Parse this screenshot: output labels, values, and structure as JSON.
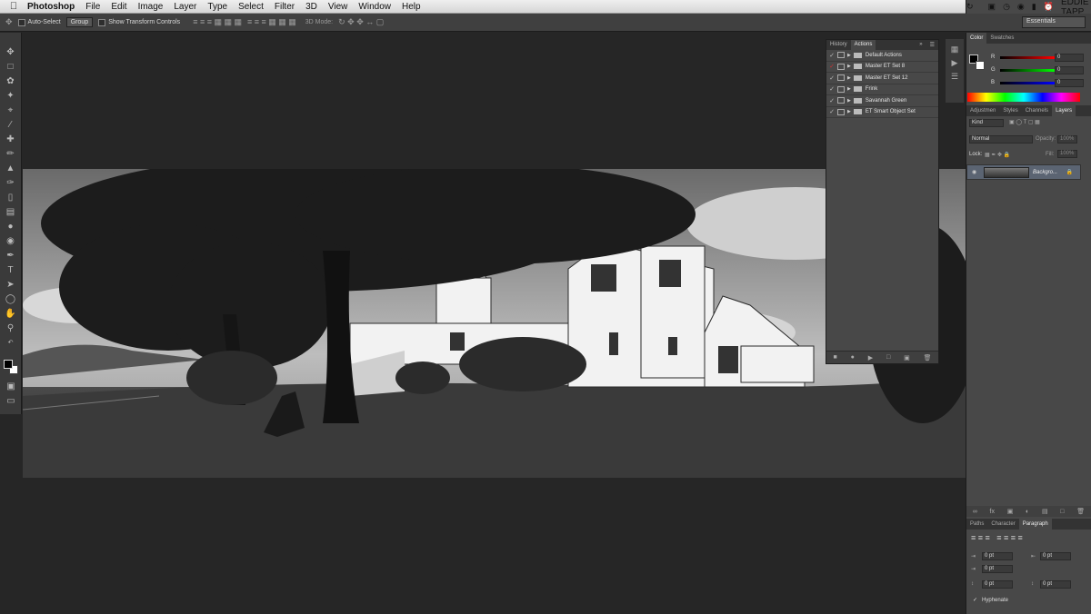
{
  "menubar": {
    "app": "Photoshop",
    "menus": [
      "File",
      "Edit",
      "Image",
      "Layer",
      "Type",
      "Select",
      "Filter",
      "3D",
      "View",
      "Window",
      "Help"
    ],
    "user": "EDDIE TAPP"
  },
  "options": {
    "auto_select": "Auto-Select",
    "group": "Group",
    "show_transform": "Show Transform Controls",
    "mode_3d": "3D Mode:",
    "workspace": "Essentials"
  },
  "actions_panel": {
    "tabs": [
      "History",
      "Actions"
    ],
    "active_tab": "Actions",
    "items": [
      {
        "label": "Default Actions",
        "checked": true
      },
      {
        "label": "Master ET Set 8",
        "checked": false
      },
      {
        "label": "Master ET Set 12",
        "checked": true
      },
      {
        "label": "Frink",
        "checked": true
      },
      {
        "label": "Savannah Green",
        "checked": true
      },
      {
        "label": "ET Smart Object Set",
        "checked": true
      }
    ]
  },
  "color_panel": {
    "tabs": [
      "Color",
      "Swatches"
    ],
    "r_label": "R",
    "g_label": "G",
    "b_label": "B",
    "r": "0",
    "g": "0",
    "b": "0"
  },
  "layers_panel": {
    "tabs": [
      "Adjustmen",
      "Styles",
      "Channels",
      "Layers"
    ],
    "kind": "Kind",
    "blend": "Normal",
    "opacity_label": "Opacity:",
    "opacity": "100%",
    "lock_label": "Lock:",
    "fill_label": "Fill:",
    "fill": "100%",
    "layer_name": "Backgro..."
  },
  "paragraph_panel": {
    "tabs": [
      "Paths",
      "Character",
      "Paragraph"
    ],
    "v1": "0 pt",
    "v2": "0 pt",
    "v3": "0 pt",
    "v4": "0 pt",
    "v5": "0 pt",
    "hyphenate": "Hyphenate"
  }
}
